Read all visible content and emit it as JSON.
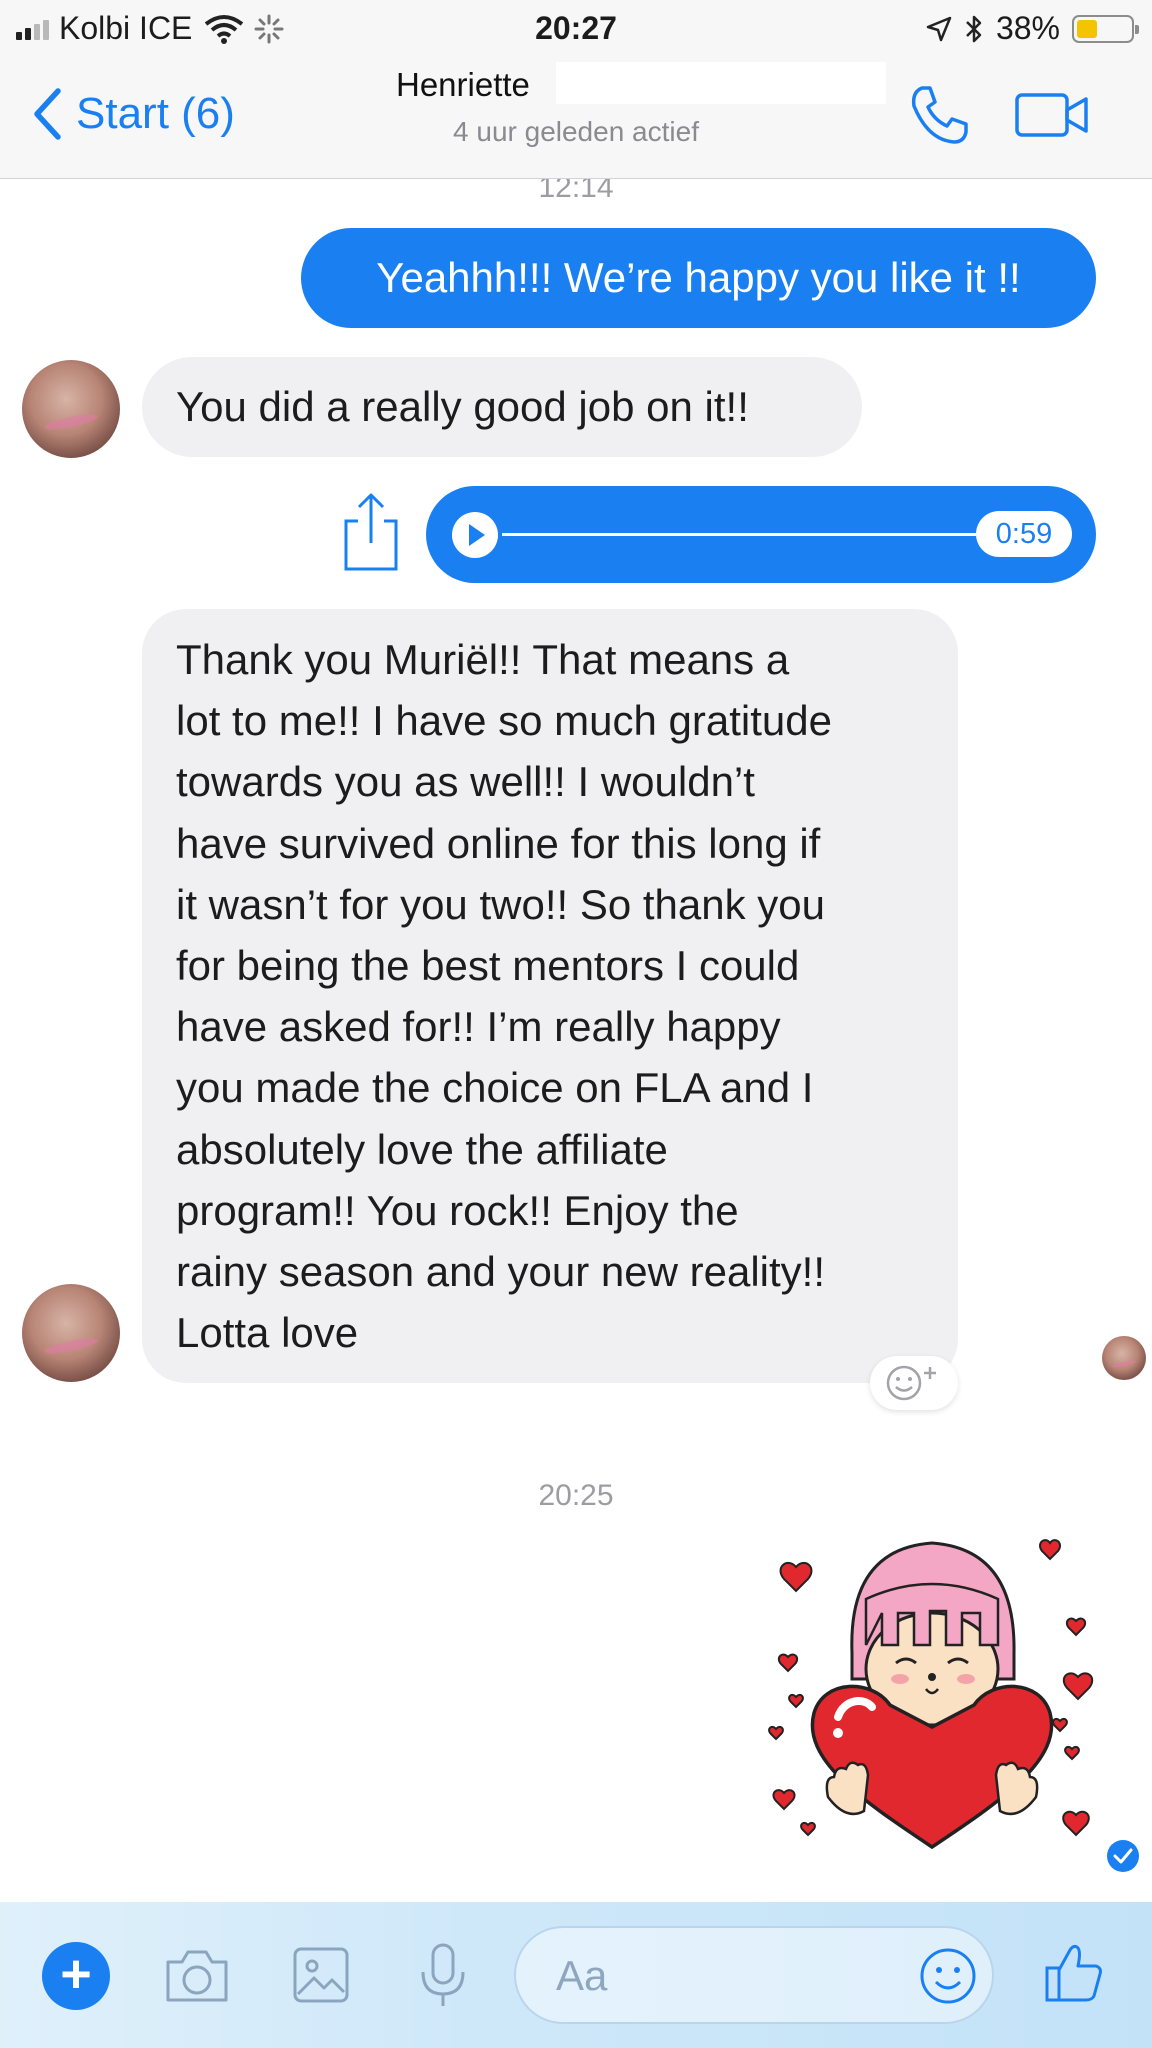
{
  "status_bar": {
    "carrier": "Kolbi ICE",
    "time": "20:27",
    "battery": "38%",
    "battery_level": 0.38
  },
  "nav": {
    "back_label": "Start (6)",
    "contact_name": "Henriette",
    "subtitle": "4 uur geleden actief"
  },
  "chat": {
    "timestamp_top": "12:14",
    "messages": [
      {
        "direction": "outgoing",
        "text": "Yeahhh!!! We’re happy you like it !!"
      },
      {
        "direction": "incoming",
        "text": "You did a really good job on it!!"
      },
      {
        "direction": "outgoing",
        "type": "audio",
        "duration": "0:59"
      },
      {
        "direction": "incoming",
        "lines": [
          "Thank you Muriël!! That means a",
          "lot to me!! I have so much gratitude",
          "towards you as well!! I wouldn’t",
          "have survived online for this long if",
          "it wasn’t for you two!! So thank you",
          "for being the best mentors I could",
          "have asked for!! I’m really happy",
          "you made the choice on FLA and I",
          "absolutely love the affiliate",
          "program!! You rock!! Enjoy the",
          "rainy season and your new reality!!",
          "Lotta love"
        ]
      }
    ],
    "timestamp_bottom": "20:25",
    "sticker": "girl-holding-heart-sticker"
  },
  "composer": {
    "placeholder": "Aa"
  },
  "colors": {
    "accent": "#1a80f2",
    "incoming_bubble": "#f0f0f2",
    "heart": "#e0282e"
  }
}
